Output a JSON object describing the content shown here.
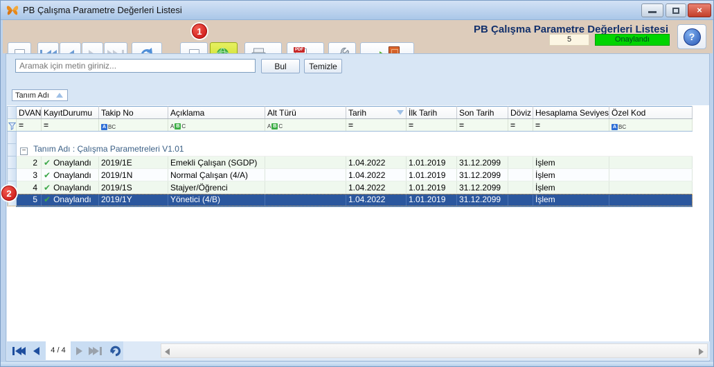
{
  "window": {
    "title": "PB Çalışma Parametre Değerleri Listesi"
  },
  "icons": {
    "eq": "=",
    "abc_a": "A",
    "abc_b": "B",
    "abc_c": "C",
    "abc_bc": "BC",
    "caret_down": "▼",
    "help": "?",
    "close": "×",
    "collapse": "−",
    "check": "✔",
    "pdf_label": "PDF"
  },
  "page_header": {
    "title": "PB Çalışma Parametre Değerleri Listesi",
    "record_no": "5",
    "status": "Onaylandı"
  },
  "search": {
    "placeholder": "Aramak için metin giriniz...",
    "find_label": "Bul",
    "clear_label": "Temizle"
  },
  "grouping": {
    "field": "Tanım Adı"
  },
  "annotations": {
    "step1": "1",
    "step2": "2"
  },
  "grid": {
    "columns": [
      {
        "label": "DVANo"
      },
      {
        "label": "KayıtDurumu"
      },
      {
        "label": "Takip No"
      },
      {
        "label": "Açıklama"
      },
      {
        "label": "Alt Türü"
      },
      {
        "label": "Tarih"
      },
      {
        "label": "İlk Tarih"
      },
      {
        "label": "Son Tarih"
      },
      {
        "label": "Döviz"
      },
      {
        "label": "Hesaplama Seviyesi"
      },
      {
        "label": "Özel Kod"
      }
    ],
    "group_label": "Tanım Adı : Çalışma Parametreleri V1.01",
    "rows": [
      {
        "dva_no": "2",
        "kayit_durumu": "Onaylandı",
        "takip_no": "2019/1E",
        "aciklama": "Emekli Çalışan (SGDP)",
        "alt_turu": "",
        "tarih": "1.04.2022",
        "ilk_tarih": "1.01.2019",
        "son_tarih": "31.12.2099",
        "doviz": "",
        "hesaplama_seviyesi": "İşlem",
        "ozel_kod": ""
      },
      {
        "dva_no": "3",
        "kayit_durumu": "Onaylandı",
        "takip_no": "2019/1N",
        "aciklama": "Normal Çalışan (4/A)",
        "alt_turu": "",
        "tarih": "1.04.2022",
        "ilk_tarih": "1.01.2019",
        "son_tarih": "31.12.2099",
        "doviz": "",
        "hesaplama_seviyesi": "İşlem",
        "ozel_kod": ""
      },
      {
        "dva_no": "4",
        "kayit_durumu": "Onaylandı",
        "takip_no": "2019/1S",
        "aciklama": "Stajyer/Öğrenci",
        "alt_turu": "",
        "tarih": "1.04.2022",
        "ilk_tarih": "1.01.2019",
        "son_tarih": "31.12.2099",
        "doviz": "",
        "hesaplama_seviyesi": "İşlem",
        "ozel_kod": ""
      },
      {
        "dva_no": "5",
        "kayit_durumu": "Onaylandı",
        "takip_no": "2019/1Y",
        "aciklama": "Yönetici (4/B)",
        "alt_turu": "",
        "tarih": "1.04.2022",
        "ilk_tarih": "1.01.2019",
        "son_tarih": "31.12.2099",
        "doviz": "",
        "hesaplama_seviyesi": "İşlem",
        "ozel_kod": ""
      }
    ]
  },
  "pager": {
    "position": "4 / 4"
  },
  "colors": {
    "status_green": "#00d400",
    "selected_row": "#2b579e",
    "title_blue": "#12306b"
  }
}
